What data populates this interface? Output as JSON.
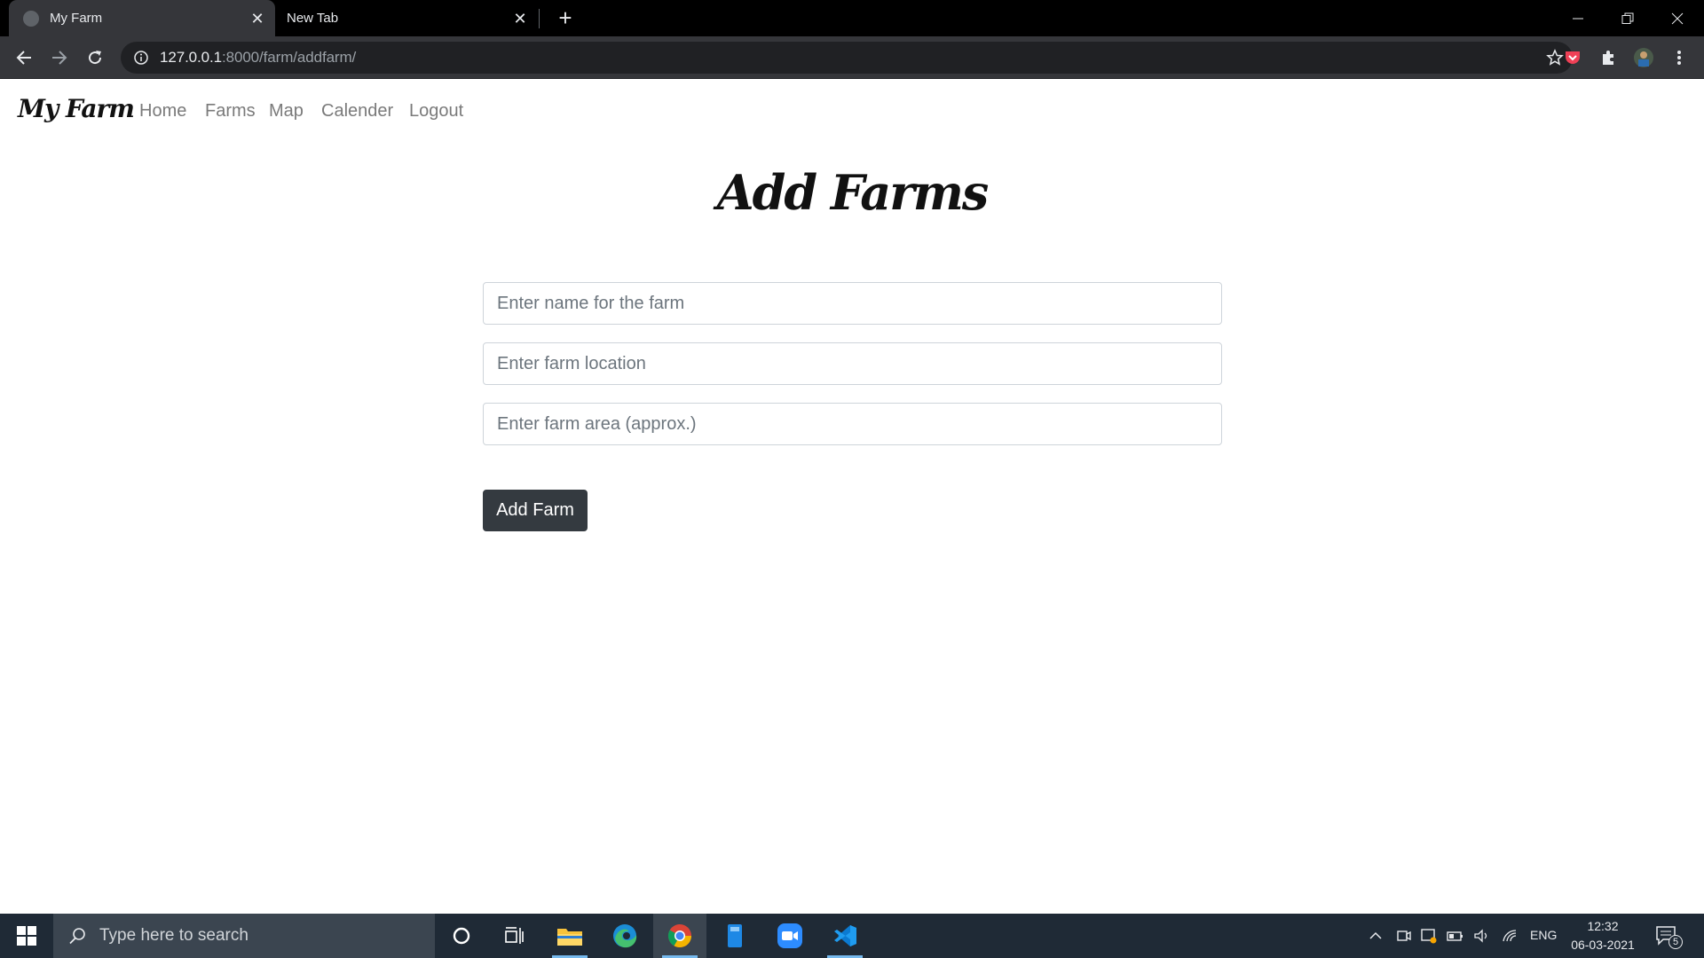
{
  "browser": {
    "tabs": [
      {
        "title": "My Farm",
        "active": true
      },
      {
        "title": "New Tab",
        "active": false
      }
    ],
    "url_host": "127.0.0.1",
    "url_path": ":8000/farm/addfarm/"
  },
  "site": {
    "brand": "My Farm",
    "nav": [
      "Home",
      "Farms",
      "Map",
      "Calender",
      "Logout"
    ]
  },
  "page": {
    "heading": "Add Farms",
    "fields": {
      "name_placeholder": "Enter name for the farm",
      "location_placeholder": "Enter farm location",
      "area_placeholder": "Enter farm area (approx.)"
    },
    "submit_label": "Add Farm"
  },
  "taskbar": {
    "search_placeholder": "Type here to search",
    "language": "ENG",
    "time": "12:32",
    "date": "06-03-2021",
    "notification_count": "5"
  },
  "colors": {
    "button_bg": "#343a40",
    "taskbar_bg": "#1f2a36",
    "chrome_toolbar": "#35363a"
  }
}
